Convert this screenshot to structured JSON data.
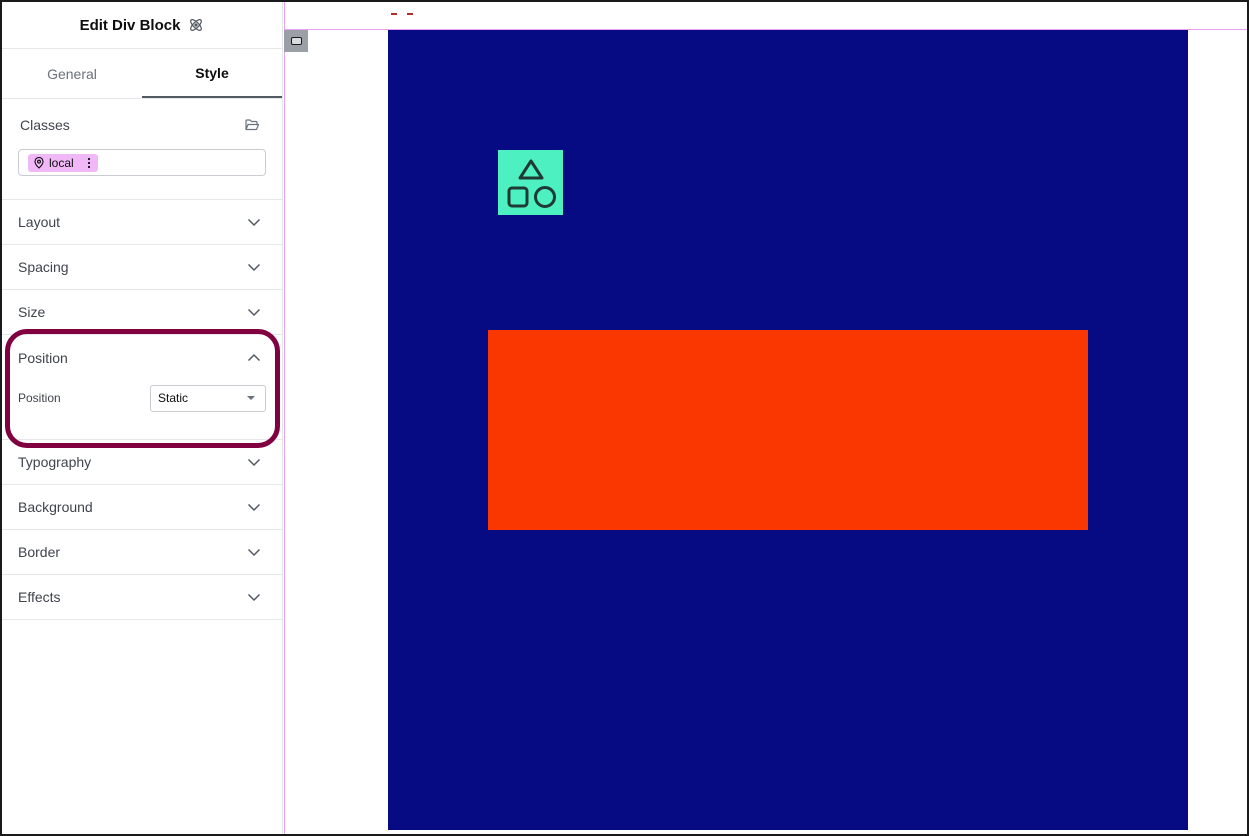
{
  "panel": {
    "title": "Edit Div Block",
    "header_icon": "atom-icon",
    "tabs": [
      {
        "label": "General",
        "active": false
      },
      {
        "label": "Style",
        "active": true
      }
    ]
  },
  "classes": {
    "label": "Classes",
    "icon": "folder-open-icon",
    "chip": {
      "label": "local",
      "icon": "map-pin-icon",
      "menu_icon": "more-vertical-icon",
      "color": "#f1b8f8"
    }
  },
  "sections": {
    "layout": "Layout",
    "spacing": "Spacing",
    "size": "Size",
    "position": "Position",
    "typography": "Typography",
    "background": "Background",
    "border": "Border",
    "effects": "Effects"
  },
  "position_control": {
    "label": "Position",
    "value": "Static"
  },
  "canvas": {
    "navy_color": "#060b84",
    "red_color": "#fa3700",
    "icon_bg_color": "#4df0c0",
    "icon": "shapes-icon",
    "highlight_color": "#800040"
  }
}
